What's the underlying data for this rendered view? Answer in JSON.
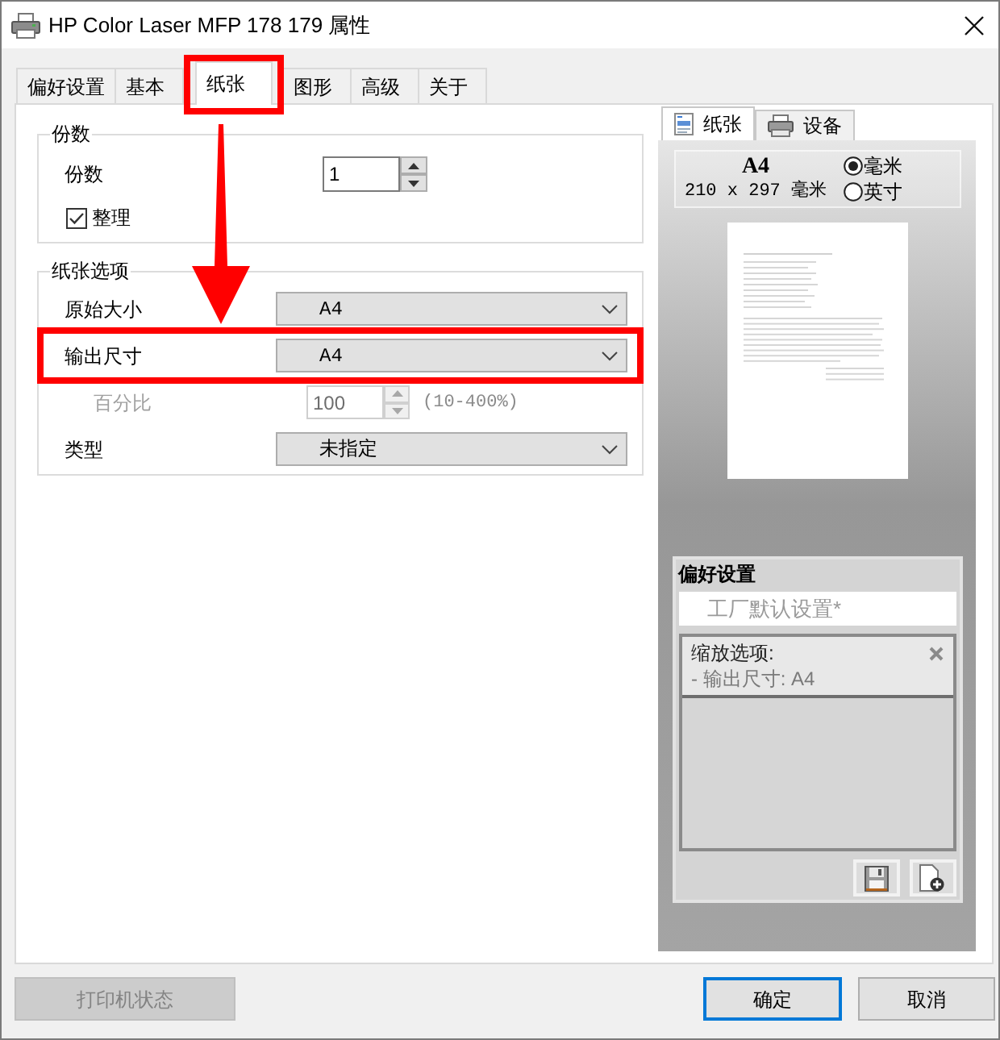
{
  "window": {
    "title": "HP Color Laser MFP 178 179 属性"
  },
  "tabs": [
    {
      "label": "偏好设置",
      "selected": false,
      "highlighted": false
    },
    {
      "label": "基本",
      "selected": false,
      "highlighted": false
    },
    {
      "label": "纸张",
      "selected": true,
      "highlighted": true
    },
    {
      "label": "图形",
      "selected": false,
      "highlighted": false
    },
    {
      "label": "高级",
      "selected": false,
      "highlighted": false
    },
    {
      "label": "关于",
      "selected": false,
      "highlighted": false
    }
  ],
  "copies_group": {
    "title": "份数",
    "copies": {
      "label": "份数",
      "value": "1"
    },
    "collate": {
      "label": "整理",
      "checked": true
    }
  },
  "paper_options": {
    "title": "纸张选项",
    "rows": [
      {
        "kind": "select",
        "label": "原始大小",
        "value": "A4",
        "disabled": false,
        "highlighted": false
      },
      {
        "kind": "select",
        "label": "输出尺寸",
        "value": "A4",
        "disabled": false,
        "highlighted": true
      },
      {
        "kind": "spin",
        "label": "百分比",
        "value": "100",
        "range": "(10-400%)",
        "disabled": true,
        "highlighted": false
      },
      {
        "kind": "select",
        "label": "类型",
        "value": "未指定",
        "disabled": false,
        "highlighted": false
      }
    ]
  },
  "preview": {
    "tabs": [
      {
        "label": "纸张",
        "selected": true
      },
      {
        "label": "设备",
        "selected": false
      }
    ],
    "paper": {
      "name": "A4",
      "size": "210 x 297 毫米"
    },
    "units": [
      {
        "label": "毫米",
        "selected": true
      },
      {
        "label": "英寸",
        "selected": false
      }
    ]
  },
  "favorites": {
    "title": "偏好设置",
    "name": {
      "value": "工厂默认设置*"
    },
    "summary": {
      "heading": "缩放选项:",
      "items": [
        "- 输出尺寸: A4"
      ]
    }
  },
  "buttons": [
    {
      "label": "打印机状态",
      "disabled": true,
      "default": false
    },
    {
      "label": "确定",
      "disabled": false,
      "default": true
    },
    {
      "label": "取消",
      "disabled": false,
      "default": false
    }
  ]
}
